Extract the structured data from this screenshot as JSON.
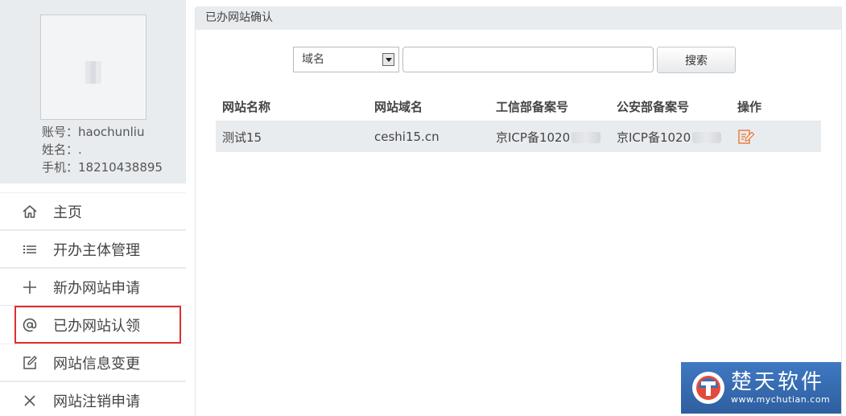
{
  "profile": {
    "account": "账号：haochunliu",
    "name": "姓名：.",
    "phone": "手机：18210438895"
  },
  "nav": {
    "items": [
      {
        "label": "主页",
        "icon": "home-icon"
      },
      {
        "label": "开办主体管理",
        "icon": "list-icon"
      },
      {
        "label": "新办网站申请",
        "icon": "plus-icon"
      },
      {
        "label": "已办网站认领",
        "icon": "at-icon",
        "active": true
      },
      {
        "label": "网站信息变更",
        "icon": "edit-icon"
      },
      {
        "label": "网站注销申请",
        "icon": "close-icon"
      }
    ]
  },
  "main": {
    "title": "已办网站确认",
    "search": {
      "select_value": "域名",
      "input_value": "",
      "button_label": "搜索"
    },
    "table": {
      "headers": [
        "网站名称",
        "网站域名",
        "工信部备案号",
        "公安部备案号",
        "操作"
      ],
      "rows": [
        {
          "name": "测试15",
          "domain": "ceshi15.cn",
          "miit": "京ICP备1020",
          "mps": "京ICP备1020"
        }
      ]
    }
  },
  "watermark": {
    "title": "楚天软件",
    "url": "www.mychutian.com"
  },
  "colors": {
    "panel_bg": "#e9ecef",
    "active_outline": "#e02f2f",
    "edit_icon": "#e8864a",
    "watermark_bg": "#3a6fb6"
  }
}
